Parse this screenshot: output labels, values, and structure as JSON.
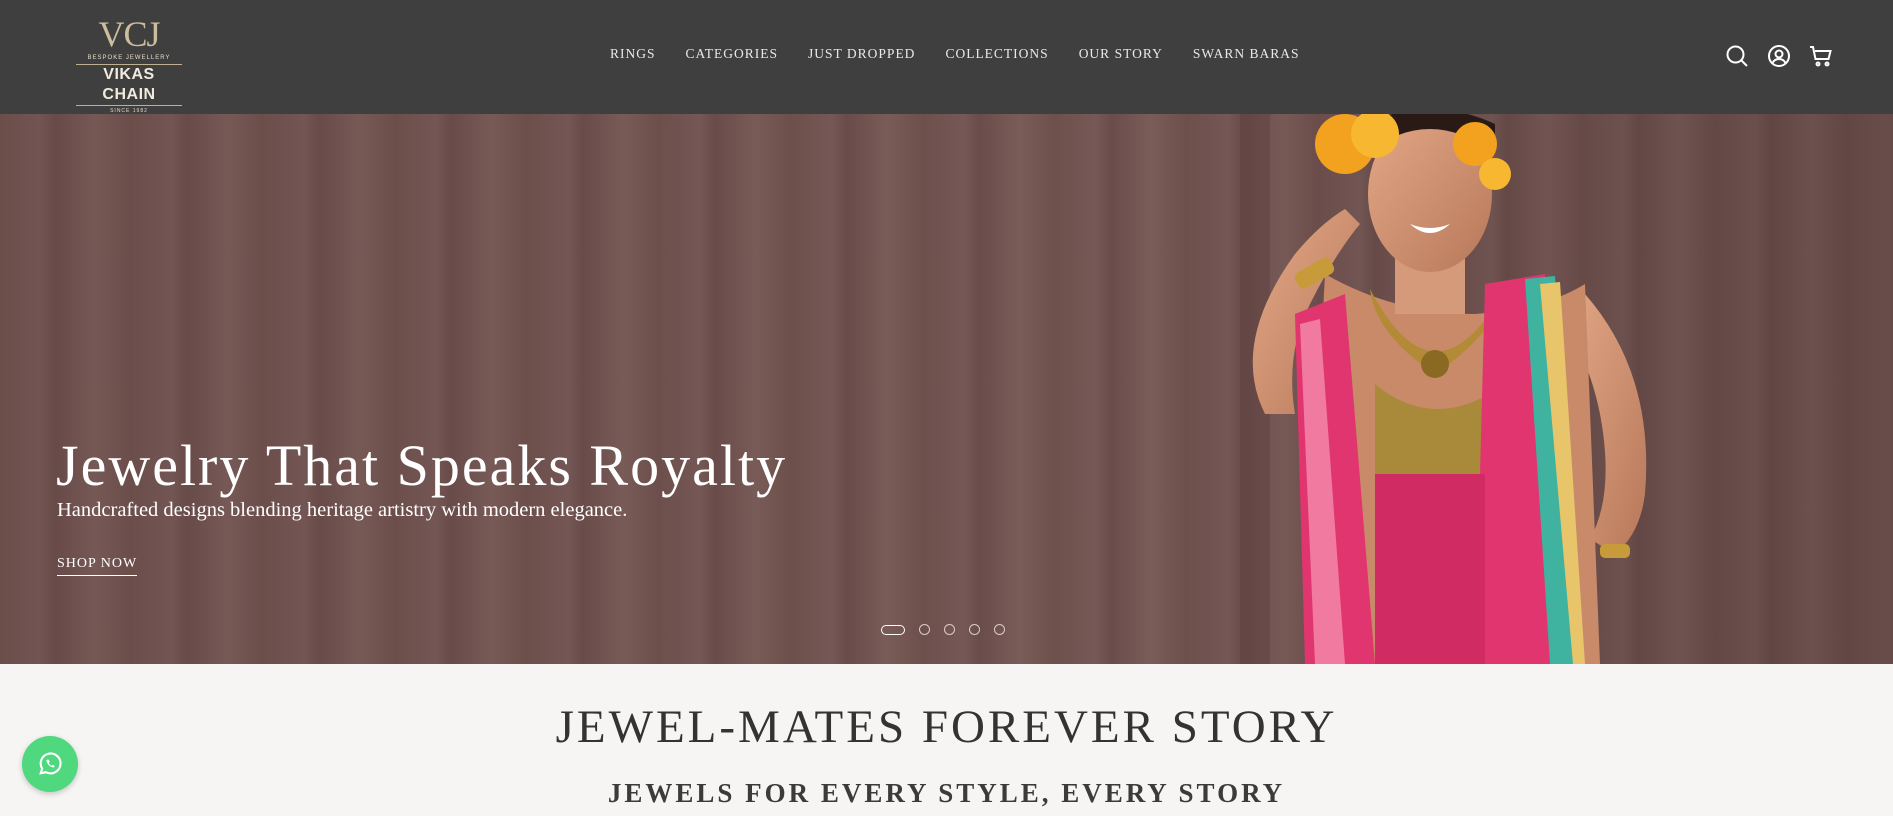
{
  "brand": {
    "monogram": "VCJ",
    "tagline": "BESPOKE JEWELLERY",
    "name": "VIKAS CHAIN",
    "since": "SINCE 1982"
  },
  "nav": {
    "items": [
      {
        "label": "RINGS"
      },
      {
        "label": "CATEGORIES"
      },
      {
        "label": "JUST DROPPED"
      },
      {
        "label": "COLLECTIONS"
      },
      {
        "label": "OUR STORY"
      },
      {
        "label": "SWARN BARAS"
      }
    ]
  },
  "header_icons": [
    "search-icon",
    "account-icon",
    "cart-icon"
  ],
  "hero": {
    "title": "Jewelry That Speaks Royalty",
    "subtitle": "Handcrafted designs blending heritage artistry with modern elegance.",
    "cta": "SHOP NOW",
    "slides_total": 5,
    "active_slide": 1
  },
  "section": {
    "title": "JEWEL-MATES FOREVER STORY",
    "subtitle": "JEWELS FOR EVERY STYLE, EVERY STORY"
  },
  "colors": {
    "header_bg": "#3f3f40",
    "hero_bg": "#6e504d",
    "page_bg": "#f6f5f3",
    "whatsapp": "#4fd87e",
    "saree_pink": "#e0356f"
  },
  "floating": {
    "icon": "whatsapp-icon"
  }
}
